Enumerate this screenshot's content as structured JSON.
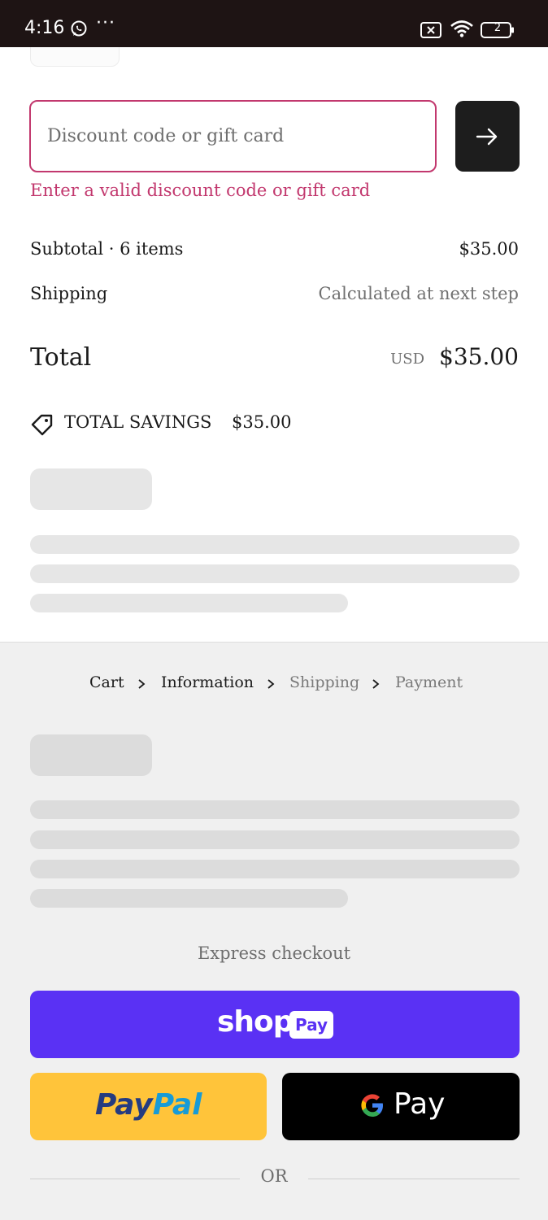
{
  "status_bar": {
    "time": "4:16",
    "more": "···",
    "battery": "2"
  },
  "discount": {
    "placeholder": "Discount code or gift card",
    "error": "Enter a valid discount code or gift card"
  },
  "summary": {
    "subtotal_label": "Subtotal · 6 items",
    "subtotal_value": "$35.00",
    "shipping_label": "Shipping",
    "shipping_value": "Calculated at next step",
    "total_label": "Total",
    "total_currency": "USD",
    "total_value": "$35.00",
    "savings_label": "TOTAL SAVINGS",
    "savings_value": "$35.00"
  },
  "breadcrumb": {
    "items": [
      "Cart",
      "Information",
      "Shipping",
      "Payment"
    ]
  },
  "express": {
    "title": "Express checkout",
    "shop_pay_brand": "shop",
    "shop_pay_badge": "Pay",
    "paypal_dark": "Pay",
    "paypal_light": "Pal",
    "gpay_label": "Pay",
    "or_label": "OR"
  },
  "colors": {
    "error": "#c2386e",
    "shop_pay": "#5a31f4",
    "paypal": "#ffc43a",
    "gpay": "#000000",
    "status_bar": "#1e1414"
  }
}
